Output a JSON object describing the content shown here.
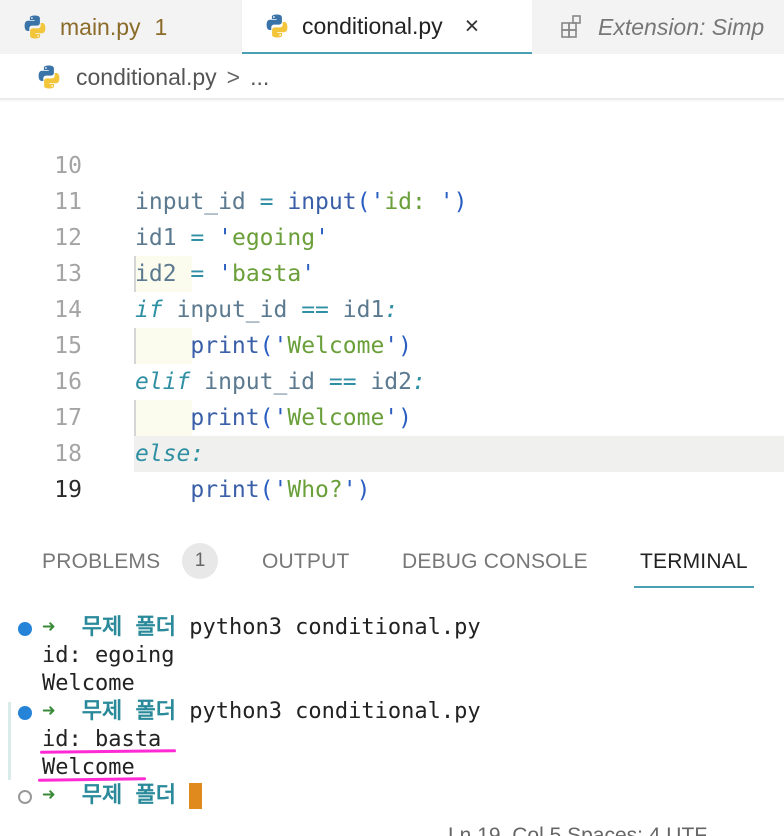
{
  "tabs": [
    {
      "label": "main.py",
      "count": "1"
    },
    {
      "label": "conditional.py",
      "close": "×"
    },
    {
      "label": "Extension: Simp"
    }
  ],
  "breadcrumb": {
    "file": "conditional.py",
    "sep": ">",
    "more": "..."
  },
  "editor": {
    "lines": [
      {
        "n": "10",
        "text": "input_id = input('id: ')"
      },
      {
        "n": "11",
        "text": "id1 = 'egoing'"
      },
      {
        "n": "12",
        "text": "id2 = 'basta'"
      },
      {
        "n": "13",
        "text": "if input_id == id1:"
      },
      {
        "n": "14",
        "text": "    print('Welcome')"
      },
      {
        "n": "15",
        "text": "elif input_id == id2:"
      },
      {
        "n": "16",
        "text": "    print('Welcome')"
      },
      {
        "n": "17",
        "text": "else:"
      },
      {
        "n": "18",
        "text": "    print('Who?')"
      },
      {
        "n": "19",
        "text": ""
      }
    ]
  },
  "panel": {
    "tabs": [
      "PROBLEMS",
      "OUTPUT",
      "DEBUG CONSOLE",
      "TERMINAL"
    ],
    "problems_count": "1"
  },
  "terminal": {
    "arrow": "➜",
    "dir": "무제 폴더",
    "cmd": "python3 conditional.py",
    "out1": "id: egoing",
    "out2": "Welcome",
    "out3": "id: basta",
    "out4": "Welcome"
  },
  "statusbar": {
    "text": "Ln 19, Col 5    Spaces: 4    UTF"
  },
  "colors": {
    "accent": "#4a9fb4",
    "highlight_mark": "#ff2ad4",
    "cursor": "#e08a1e"
  }
}
